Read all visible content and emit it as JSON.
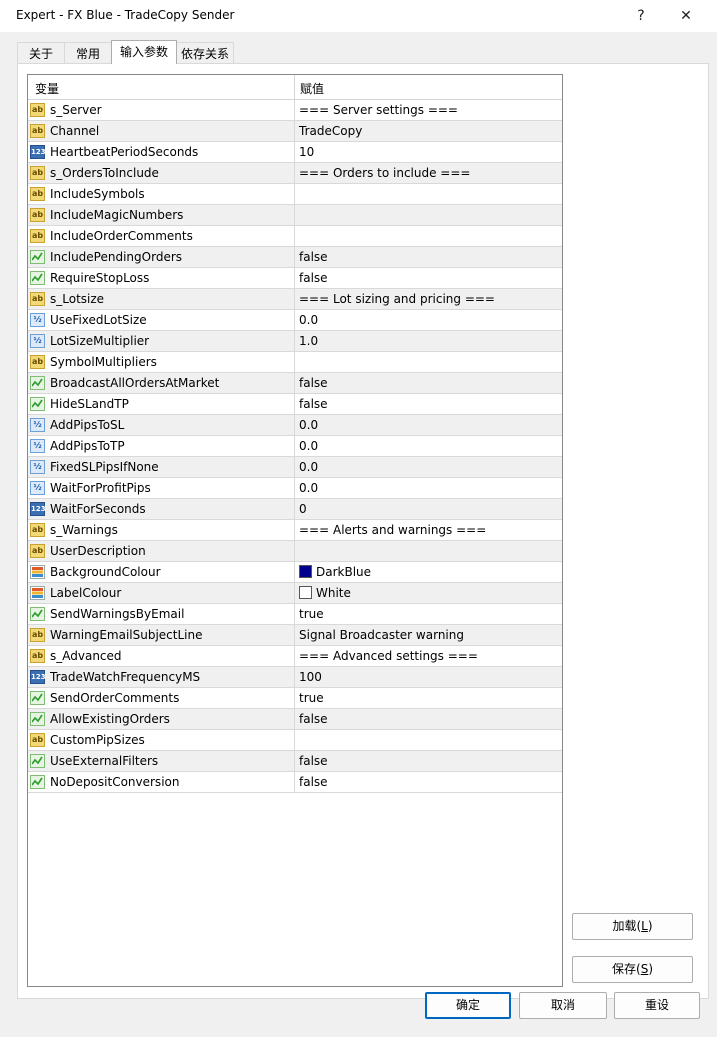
{
  "window": {
    "title": "Expert - FX Blue - TradeCopy Sender",
    "help_glyph": "?",
    "close_glyph": "✕"
  },
  "tabs": [
    {
      "label": "关于"
    },
    {
      "label": "常用"
    },
    {
      "label": "输入参数"
    },
    {
      "label": "依存关系"
    }
  ],
  "grid": {
    "col_variable": "变量",
    "col_value": "赋值",
    "rows": [
      {
        "icon": "ab",
        "name": "s_Server",
        "value": "=== Server settings ==="
      },
      {
        "icon": "ab",
        "name": "Channel",
        "value": "TradeCopy"
      },
      {
        "icon": "n123",
        "name": "HeartbeatPeriodSeconds",
        "value": "10"
      },
      {
        "icon": "ab",
        "name": "s_OrdersToInclude",
        "value": "=== Orders to include ==="
      },
      {
        "icon": "ab",
        "name": "IncludeSymbols",
        "value": ""
      },
      {
        "icon": "ab",
        "name": "IncludeMagicNumbers",
        "value": ""
      },
      {
        "icon": "ab",
        "name": "IncludeOrderComments",
        "value": ""
      },
      {
        "icon": "bool",
        "name": "IncludePendingOrders",
        "value": "false"
      },
      {
        "icon": "bool",
        "name": "RequireStopLoss",
        "value": "false"
      },
      {
        "icon": "ab",
        "name": "s_Lotsize",
        "value": "=== Lot sizing and pricing ==="
      },
      {
        "icon": "flt",
        "name": "UseFixedLotSize",
        "value": "0.0"
      },
      {
        "icon": "flt",
        "name": "LotSizeMultiplier",
        "value": "1.0"
      },
      {
        "icon": "ab",
        "name": "SymbolMultipliers",
        "value": ""
      },
      {
        "icon": "bool",
        "name": "BroadcastAllOrdersAtMarket",
        "value": "false"
      },
      {
        "icon": "bool",
        "name": "HideSLandTP",
        "value": "false"
      },
      {
        "icon": "flt",
        "name": "AddPipsToSL",
        "value": "0.0"
      },
      {
        "icon": "flt",
        "name": "AddPipsToTP",
        "value": "0.0"
      },
      {
        "icon": "flt",
        "name": "FixedSLPipsIfNone",
        "value": "0.0"
      },
      {
        "icon": "flt",
        "name": "WaitForProfitPips",
        "value": "0.0"
      },
      {
        "icon": "n123",
        "name": "WaitForSeconds",
        "value": "0"
      },
      {
        "icon": "ab",
        "name": "s_Warnings",
        "value": "=== Alerts and warnings ==="
      },
      {
        "icon": "ab",
        "name": "UserDescription",
        "value": ""
      },
      {
        "icon": "col",
        "name": "BackgroundColour",
        "value": "DarkBlue",
        "swatch": "#00008b"
      },
      {
        "icon": "col",
        "name": "LabelColour",
        "value": "White",
        "swatch": "#ffffff"
      },
      {
        "icon": "bool",
        "name": "SendWarningsByEmail",
        "value": "true"
      },
      {
        "icon": "ab",
        "name": "WarningEmailSubjectLine",
        "value": "Signal Broadcaster warning"
      },
      {
        "icon": "ab",
        "name": "s_Advanced",
        "value": "=== Advanced settings ==="
      },
      {
        "icon": "n123",
        "name": "TradeWatchFrequencyMS",
        "value": "100"
      },
      {
        "icon": "bool",
        "name": "SendOrderComments",
        "value": "true"
      },
      {
        "icon": "bool",
        "name": "AllowExistingOrders",
        "value": "false"
      },
      {
        "icon": "ab",
        "name": "CustomPipSizes",
        "value": ""
      },
      {
        "icon": "bool",
        "name": "UseExternalFilters",
        "value": "false"
      },
      {
        "icon": "bool",
        "name": "NoDepositConversion",
        "value": "false"
      }
    ]
  },
  "side_buttons": {
    "load": {
      "label": "加载(",
      "key": "L",
      "end": ")"
    },
    "save": {
      "label": "保存(",
      "key": "S",
      "end": ")"
    }
  },
  "footer_buttons": {
    "ok": "确定",
    "cancel": "取消",
    "reset": "重设"
  },
  "icon_glyphs": {
    "ab": "ab",
    "n123": "123",
    "flt": "½"
  }
}
